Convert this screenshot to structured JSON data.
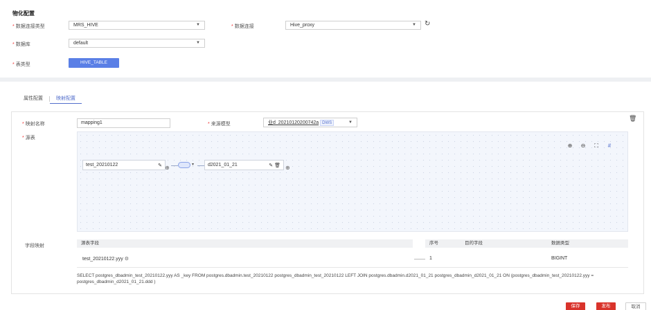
{
  "section_title": "物化配置",
  "form": {
    "conn_type_label": "数据连接类型",
    "conn_type_value": "MRS_HIVE",
    "conn_label": "数据连接",
    "conn_value": "Hive_proxy",
    "db_label": "数据库",
    "db_value": "default",
    "table_type_label": "表类型",
    "table_type_value": "HIVE_TABLE"
  },
  "tabs": [
    "属性配置",
    "映射配置"
  ],
  "mapping": {
    "name_label": "映射名称",
    "name_value": "mapping1",
    "source_model_label": "来源模型",
    "source_model_value": "业d_20210120200742a",
    "source_model_tag": "DWS",
    "source_table_label": "源表",
    "node_left": "test_20210122",
    "node_right": "d2021_01_21"
  },
  "field_mapping": {
    "label": "字段映射",
    "headers": [
      "源表字段",
      "序号",
      "目的字段",
      "数据类型"
    ],
    "row": {
      "source": "test_20210122.yyy",
      "index": "1",
      "target": "",
      "type": "BIGINT"
    },
    "sql": "SELECT postgres_dbadmin_test_20210122.yyy AS _key FROM postgres.dbadmin.test_20210122 postgres_dbadmin_test_20210122 LEFT JOIN postgres.dbadmin.d2021_01_21 postgres_dbadmin_d2021_01_21 ON (postgres_dbadmin_test_20210122.yyy = postgres_dbadmin_d2021_01_21.ddd )"
  },
  "footer": {
    "save": "保存",
    "publish": "发布",
    "cancel": "取消"
  },
  "colors": {
    "accent": "#526ecc",
    "danger": "#d9332b",
    "required": "#ee3333"
  },
  "icons": [
    "refresh-icon",
    "edit-icon",
    "plus-circle-icon",
    "join-icon",
    "delete-icon",
    "zoom-in-icon",
    "zoom-out-icon",
    "fit-icon",
    "grid-icon",
    "settings-icon"
  ]
}
